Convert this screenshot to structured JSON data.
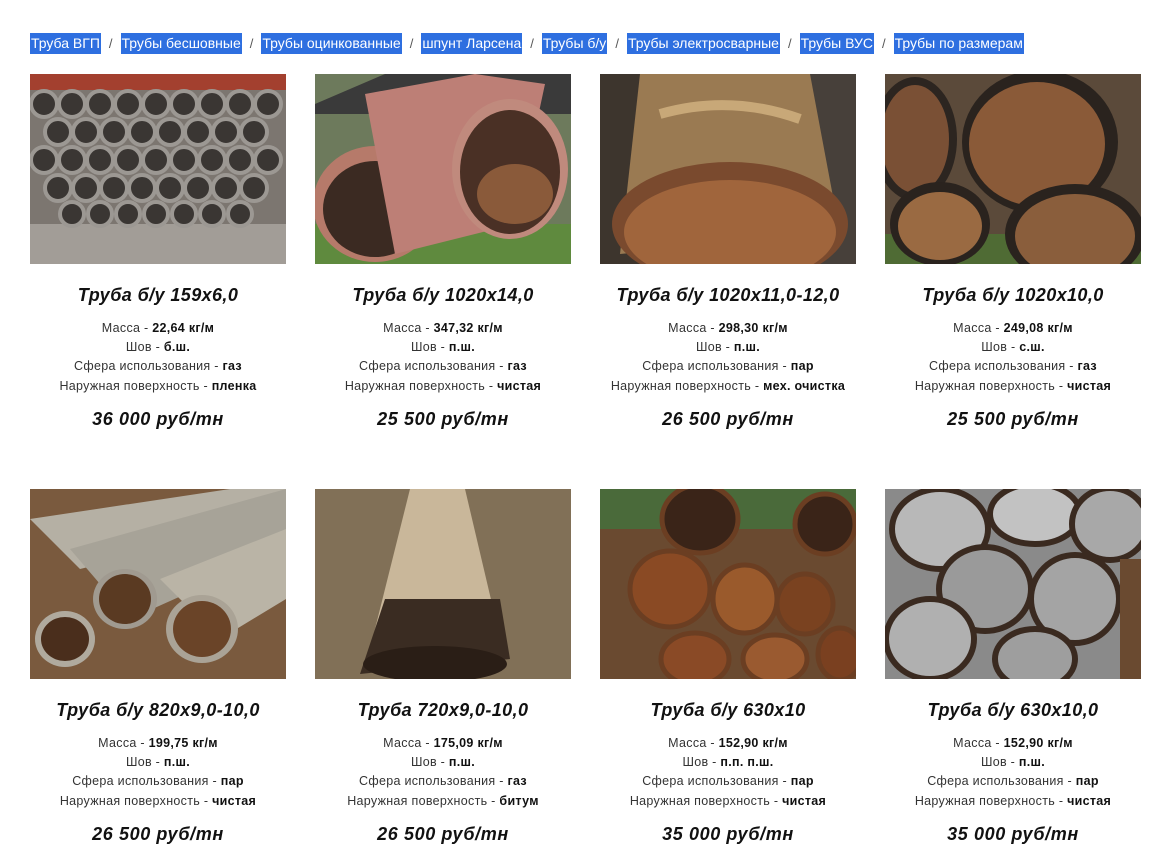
{
  "breadcrumbs": [
    "Труба ВГП",
    "Трубы бесшовные",
    "Трубы оцинкованные",
    "шпунт Ларсена",
    "Трубы б/у",
    "Трубы электросварные",
    "Трубы ВУС",
    "Трубы по размерам"
  ],
  "breadcrumb_separator": "/",
  "spec_labels": {
    "mass": "Масса - ",
    "seam": "Шов - ",
    "usage": "Сфера использования - ",
    "surface": "Наружная поверхность - "
  },
  "products": [
    {
      "title": "Труба б/у 159x6,0",
      "mass": "22,64 кг/м",
      "seam": "б.ш.",
      "usage": "газ",
      "surface": "пленка",
      "price": "36 000 руб/тн",
      "photo_icon": "pipe-bundle-photo"
    },
    {
      "title": "Труба б/у 1020x14,0",
      "mass": "347,32 кг/м",
      "seam": "п.ш.",
      "usage": "газ",
      "surface": "чистая",
      "price": "25 500 руб/тн",
      "photo_icon": "large-pipe-photo"
    },
    {
      "title": "Труба б/у 1020x11,0-12,0",
      "mass": "298,30 кг/м",
      "seam": "п.ш.",
      "usage": "пар",
      "surface": "мех. очистка",
      "price": "26 500 руб/тн",
      "photo_icon": "large-pipe-photo"
    },
    {
      "title": "Труба б/у 1020x10,0",
      "mass": "249,08 кг/м",
      "seam": "с.ш.",
      "usage": "газ",
      "surface": "чистая",
      "price": "25 500 руб/тн",
      "photo_icon": "pipe-stack-photo"
    },
    {
      "title": "Труба б/у 820x9,0-10,0",
      "mass": "199,75 кг/м",
      "seam": "п.ш.",
      "usage": "пар",
      "surface": "чистая",
      "price": "26 500 руб/тн",
      "photo_icon": "pipe-stack-photo"
    },
    {
      "title": "Труба 720x9,0-10,0",
      "mass": "175,09 кг/м",
      "seam": "п.ш.",
      "usage": "газ",
      "surface": "битум",
      "price": "26 500 руб/тн",
      "photo_icon": "bitumen-pipe-photo"
    },
    {
      "title": "Труба б/у 630x10",
      "mass": "152,90 кг/м",
      "seam": "п.п. п.ш.",
      "usage": "пар",
      "surface": "чистая",
      "price": "35 000 руб/тн",
      "photo_icon": "rusty-pipe-stack-photo"
    },
    {
      "title": "Труба б/у 630x10,0",
      "mass": "152,90 кг/м",
      "seam": "п.ш.",
      "usage": "пар",
      "surface": "чистая",
      "price": "35 000 руб/тн",
      "photo_icon": "rusty-pipe-stack-photo"
    }
  ]
}
